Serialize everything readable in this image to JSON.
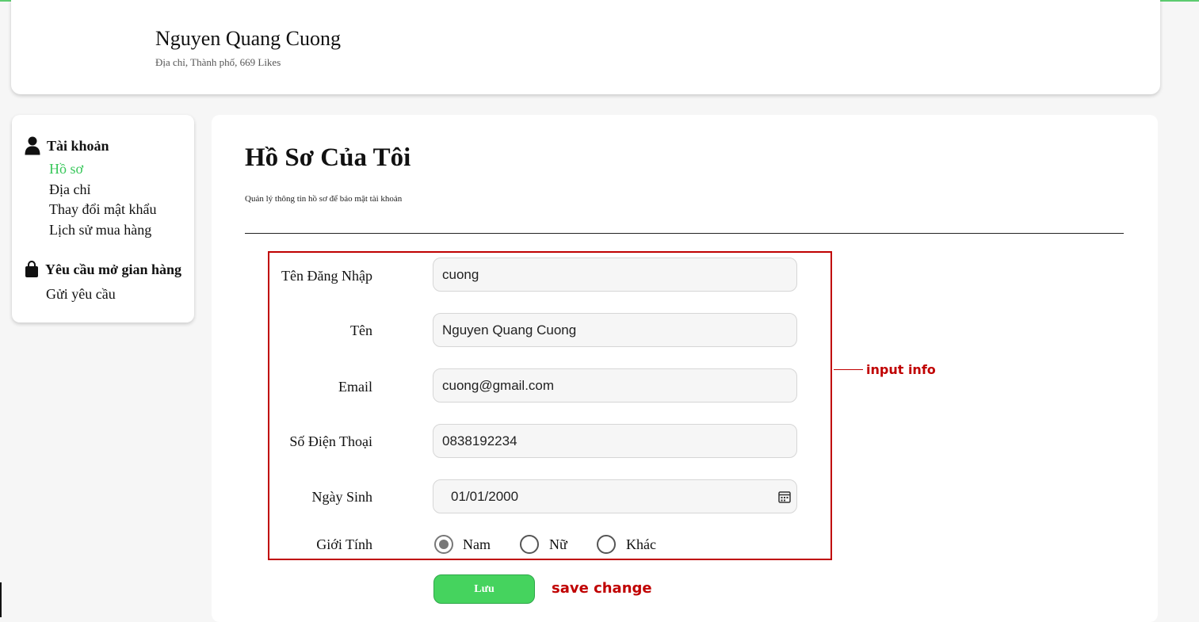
{
  "header": {
    "user_name": "Nguyen Quang Cuong",
    "user_sub": "Địa chỉ, Thành phố, 669 Likes"
  },
  "sidebar": {
    "account": {
      "title": "Tài khoản",
      "icon": "user-icon",
      "items": [
        {
          "label": "Hồ sơ",
          "active": true
        },
        {
          "label": "Địa chỉ",
          "active": false
        },
        {
          "label": "Thay đổi mật khẩu",
          "active": false
        },
        {
          "label": "Lịch sử mua hàng",
          "active": false
        }
      ]
    },
    "store": {
      "title": "Yêu cầu mở gian hàng",
      "icon": "shopping-bag-icon",
      "items": [
        {
          "label": "Gửi yêu cầu",
          "active": false
        }
      ]
    }
  },
  "main": {
    "title": "Hồ Sơ Của Tôi",
    "subtitle": "Quản lý thông tin hồ sơ để bảo mật tài khoản",
    "fields": {
      "username": {
        "label": "Tên Đăng Nhập",
        "value": "cuong"
      },
      "name": {
        "label": "Tên",
        "value": "Nguyen Quang Cuong"
      },
      "email": {
        "label": "Email",
        "value": "cuong@gmail.com"
      },
      "phone": {
        "label": "Số Điện Thoại",
        "value": "0838192234"
      },
      "birthday": {
        "label": "Ngày Sinh",
        "value": "01/01/2000"
      }
    },
    "gender": {
      "label": "Giới Tính",
      "options": [
        "Nam",
        "Nữ",
        "Khác"
      ],
      "selected": "Nam"
    },
    "save_label": "Lưu"
  },
  "annotations": {
    "input_info": "input info",
    "save_change": "save change"
  },
  "colors": {
    "accent": "#45d35e",
    "active_link": "#38c75a",
    "annotation": "#c00000"
  }
}
